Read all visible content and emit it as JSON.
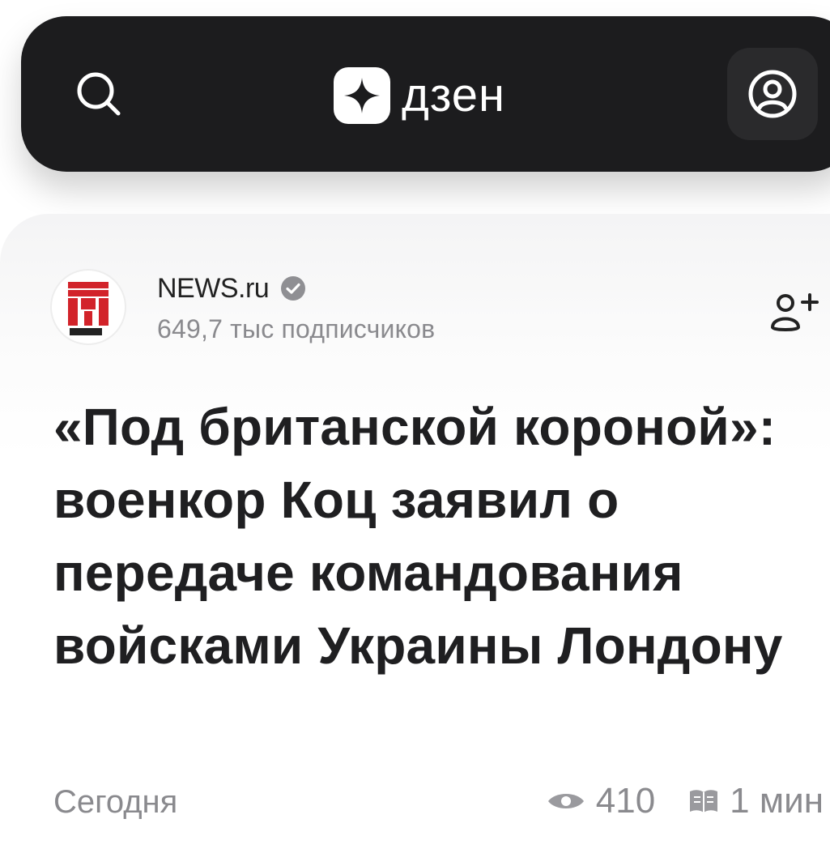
{
  "header": {
    "brand_name": "дзен",
    "icons": {
      "search": "search-icon",
      "logo": "dzen-star-logo-icon",
      "profile": "user-profile-icon"
    }
  },
  "channel": {
    "name": "NEWS.ru",
    "verified": true,
    "subscribers": "649,7 тыс подписчиков",
    "avatar_icon": "newsru-logo-icon",
    "subscribe_icon": "add-user-icon"
  },
  "article": {
    "title": "«Под британской короной»: военкор Коц заявил о передаче командования войсками Украины Лондону",
    "date": "Сегодня",
    "views": "410",
    "read_time": "1 мин",
    "views_icon": "eye-icon",
    "read_time_icon": "book-icon"
  },
  "colors": {
    "header_bg": "#1c1c1e",
    "brand_red": "#d2232a",
    "text_primary": "#1f1f21",
    "text_secondary": "#8a8a8e"
  }
}
